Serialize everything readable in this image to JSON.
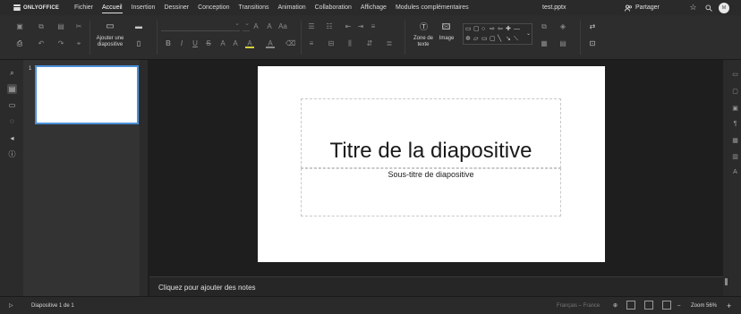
{
  "app": {
    "logo_text": "ONLYOFFICE",
    "document_title": "test.pptx",
    "share_label": "Partager",
    "avatar_initials": "M"
  },
  "menu": {
    "items": [
      "Fichier",
      "Accueil",
      "Insertion",
      "Dessiner",
      "Conception",
      "Transitions",
      "Animation",
      "Collaboration",
      "Affichage",
      "Modules complémentaires"
    ],
    "active": "Accueil"
  },
  "toolbar": {
    "add_slide_label_line1": "Ajouter une",
    "add_slide_label_line2": "diapositive",
    "text_box_label_line1": "Zone de",
    "text_box_label_line2": "texte",
    "image_label": "Image"
  },
  "thumbnails": {
    "items": [
      {
        "number": "1"
      }
    ]
  },
  "slide": {
    "title": "Titre de la diapositive",
    "subtitle": "Sous-titre de diapositive"
  },
  "notes": {
    "placeholder": "Cliquez pour ajouter des notes"
  },
  "statusbar": {
    "slide_counter": "Diapositive 1 de 1",
    "language": "Français – France",
    "zoom_label": "Zoom 56%"
  },
  "icons": {
    "top": [
      "search-icon",
      "star-icon",
      "settings-icon"
    ],
    "left_rail": [
      "search-icon",
      "slides-icon",
      "comments-icon",
      "chat-icon",
      "announce-icon",
      "info-icon"
    ],
    "right_rail": [
      "slide-settings-icon",
      "shape-settings-icon",
      "image-settings-icon",
      "paragraph-settings-icon",
      "table-settings-icon",
      "chart-settings-icon",
      "textart-settings-icon"
    ]
  },
  "colors": {
    "accent": "#4a90d9",
    "background": "#1e1e1e",
    "toolbar": "#2d2d2d"
  }
}
